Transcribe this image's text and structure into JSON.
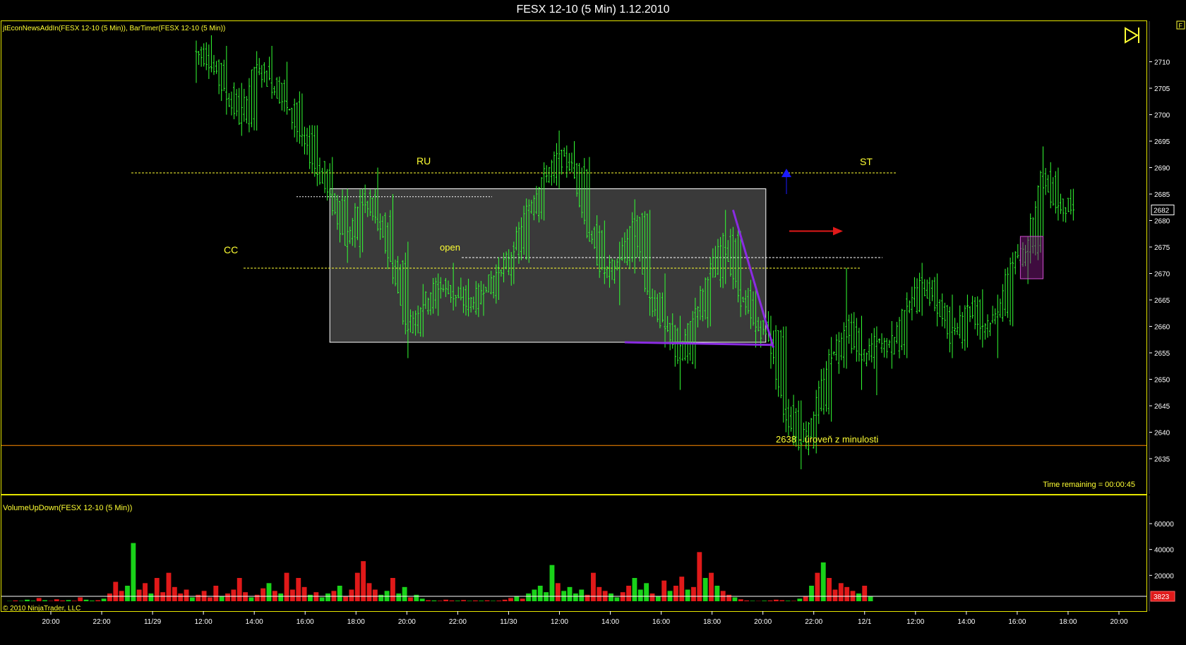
{
  "window": {
    "title": "FESX 12-10 (5 Min)  1.12.2010"
  },
  "panels": {
    "price_label": "jtEconNewsAddIn(FESX 12-10 (5 Min)), BarTimer(FESX 12-10 (5 Min))",
    "volume_label": "VolumeUpDown(FESX 12-10 (5 Min))",
    "copyright": "© 2010 NinjaTrader, LLC",
    "time_remaining": "Time remaining = 00:00:45",
    "corner_button": "F"
  },
  "annotations": {
    "cc": "CC",
    "ru": "RU",
    "open": "open",
    "st": "ST",
    "level_note": "2638 - úroveň z minulosti"
  },
  "colors": {
    "bar": "#33ff33",
    "volume_up": "#19d219",
    "volume_down": "#e01919",
    "border": "#e6e600",
    "level_line": "#ffff33",
    "orange_line": "#ff8c00",
    "trend_line": "#8a2be2",
    "range_box": "#3a3a3a",
    "entry_box": "#8b1a8b",
    "up_arrow": "#1a1aff",
    "right_arrow": "#e01919"
  },
  "chart_data": [
    {
      "type": "bar",
      "title": "FESX 12-10 (5 Min)  1.12.2010",
      "x_tick_labels": [
        "20:00",
        "22:00",
        "11/29",
        "12:00",
        "14:00",
        "16:00",
        "18:00",
        "20:00",
        "22:00",
        "11/30",
        "12:00",
        "14:00",
        "16:00",
        "18:00",
        "20:00",
        "22:00",
        "12/1",
        "12:00",
        "14:00",
        "16:00",
        "18:00",
        "20:00"
      ],
      "ylim": [
        2631,
        2715
      ],
      "y_ticks": [
        2635,
        2640,
        2645,
        2650,
        2655,
        2660,
        2665,
        2670,
        2675,
        2680,
        2685,
        2690,
        2695,
        2700,
        2705,
        2710
      ],
      "last_price": 2682,
      "ohlc_path": [
        [
          0,
          2709,
          2714,
          2706,
          2712
        ],
        [
          6,
          2712,
          2715,
          2708,
          2710
        ],
        [
          12,
          2710,
          2713,
          2700,
          2704
        ],
        [
          18,
          2704,
          2706,
          2696,
          2699
        ],
        [
          24,
          2699,
          2712,
          2697,
          2709
        ],
        [
          30,
          2709,
          2713,
          2703,
          2706
        ],
        [
          36,
          2706,
          2710,
          2700,
          2702
        ],
        [
          42,
          2702,
          2704,
          2694,
          2696
        ],
        [
          48,
          2696,
          2698,
          2688,
          2690
        ],
        [
          54,
          2690,
          2692,
          2682,
          2684
        ],
        [
          60,
          2684,
          2686,
          2672,
          2676
        ],
        [
          66,
          2676,
          2686,
          2674,
          2684
        ],
        [
          72,
          2684,
          2690,
          2678,
          2680
        ],
        [
          78,
          2680,
          2685,
          2668,
          2672
        ],
        [
          84,
          2672,
          2676,
          2654,
          2660
        ],
        [
          90,
          2660,
          2668,
          2658,
          2664
        ],
        [
          96,
          2664,
          2670,
          2662,
          2668
        ],
        [
          102,
          2668,
          2672,
          2663,
          2666
        ],
        [
          108,
          2666,
          2669,
          2662,
          2664
        ],
        [
          114,
          2664,
          2668,
          2662,
          2667
        ],
        [
          120,
          2667,
          2672,
          2665,
          2670
        ],
        [
          126,
          2670,
          2676,
          2668,
          2674
        ],
        [
          132,
          2674,
          2684,
          2672,
          2682
        ],
        [
          138,
          2682,
          2691,
          2680,
          2688
        ],
        [
          144,
          2688,
          2697,
          2686,
          2692
        ],
        [
          150,
          2692,
          2695,
          2688,
          2690
        ],
        [
          156,
          2690,
          2692,
          2676,
          2678
        ],
        [
          162,
          2678,
          2680,
          2668,
          2670
        ],
        [
          168,
          2670,
          2676,
          2664,
          2672
        ],
        [
          174,
          2672,
          2684,
          2670,
          2680
        ],
        [
          180,
          2680,
          2682,
          2662,
          2666
        ],
        [
          186,
          2666,
          2670,
          2656,
          2660
        ],
        [
          192,
          2660,
          2662,
          2648,
          2654
        ],
        [
          198,
          2654,
          2664,
          2652,
          2662
        ],
        [
          204,
          2662,
          2672,
          2660,
          2670
        ],
        [
          210,
          2670,
          2682,
          2668,
          2676
        ],
        [
          216,
          2676,
          2678,
          2662,
          2666
        ],
        [
          222,
          2666,
          2668,
          2656,
          2660
        ],
        [
          228,
          2660,
          2662,
          2652,
          2658
        ],
        [
          234,
          2658,
          2660,
          2640,
          2644
        ],
        [
          240,
          2644,
          2646,
          2633,
          2638
        ],
        [
          246,
          2638,
          2648,
          2636,
          2644
        ],
        [
          252,
          2644,
          2658,
          2642,
          2654
        ],
        [
          258,
          2654,
          2671,
          2652,
          2660
        ],
        [
          264,
          2660,
          2662,
          2648,
          2654
        ],
        [
          270,
          2654,
          2660,
          2647,
          2657
        ],
        [
          276,
          2657,
          2661,
          2652,
          2656
        ],
        [
          282,
          2656,
          2666,
          2654,
          2664
        ],
        [
          288,
          2664,
          2672,
          2662,
          2668
        ],
        [
          294,
          2668,
          2670,
          2660,
          2664
        ],
        [
          300,
          2664,
          2666,
          2654,
          2658
        ],
        [
          306,
          2658,
          2666,
          2656,
          2664
        ],
        [
          312,
          2664,
          2667,
          2656,
          2660
        ],
        [
          318,
          2660,
          2666,
          2654,
          2662
        ],
        [
          324,
          2662,
          2674,
          2660,
          2672
        ],
        [
          330,
          2672,
          2677,
          2668,
          2675
        ],
        [
          336,
          2675,
          2694,
          2673,
          2688
        ],
        [
          342,
          2688,
          2690,
          2680,
          2683
        ],
        [
          348,
          2683,
          2686,
          2680,
          2682
        ]
      ],
      "levels": [
        2689,
        2671,
        2673,
        2637.5
      ],
      "range_box": {
        "x": [
          53,
          226
        ],
        "y": [
          2657,
          2686
        ]
      },
      "entry_box": {
        "x": [
          327,
          336
        ],
        "y": [
          2669,
          2677
        ]
      },
      "trend_lines": [
        {
          "from": [
            213,
            2682
          ],
          "to": [
            229,
            2656
          ]
        },
        {
          "from": [
            170,
            2657
          ],
          "to": [
            229,
            2656.5
          ]
        }
      ],
      "ylabel": ""
    },
    {
      "type": "bar",
      "title": "VolumeUpDown(FESX 12-10 (5 Min))",
      "ylim": [
        0,
        72000
      ],
      "y_ticks": [
        20000,
        40000,
        60000
      ],
      "last_value": 3823,
      "series": [
        {
          "values": [
            200,
            600,
            300,
            1200,
            400,
            2500,
            800,
            300,
            1500,
            600,
            900,
            400,
            3000,
            1200,
            500,
            800,
            2000,
            6000,
            15000,
            8000,
            12000,
            45000,
            9000,
            14000,
            6000,
            18000,
            7000,
            22000,
            11000,
            6000,
            9000,
            3000,
            5000,
            8000,
            3000,
            12000,
            4000,
            6000,
            9000,
            18000,
            7000,
            3000,
            5000,
            10000,
            14000,
            8000,
            6000,
            22000,
            9000,
            18000,
            11000,
            5000,
            7000,
            3000,
            6000,
            8000,
            12000,
            4000,
            9000,
            22000,
            31000,
            14000,
            9000,
            5000,
            8000,
            18000,
            6000,
            11000,
            3000,
            5000,
            2000,
            800,
            600,
            400,
            1200,
            600,
            400,
            900,
            300,
            600,
            400,
            700,
            300,
            500,
            1200,
            2500,
            4000,
            2000,
            6000,
            9000,
            12000,
            7000,
            28000,
            14000,
            8000,
            11000,
            6000,
            9000,
            5000,
            22000,
            11000,
            8000,
            6000,
            3000,
            7000,
            12000,
            18000,
            9000,
            14000,
            6000,
            4000,
            16000,
            8000,
            12000,
            19000,
            9000,
            11000,
            38000,
            18000,
            22000,
            12000,
            8000,
            5000,
            3000,
            1500,
            600,
            300,
            200,
            400,
            600,
            1200,
            800,
            400,
            300,
            2000,
            4000,
            12000,
            22000,
            30000,
            18000,
            9000,
            14000,
            11000,
            8000,
            6000,
            12000,
            4000
          ]
        }
      ]
    }
  ]
}
